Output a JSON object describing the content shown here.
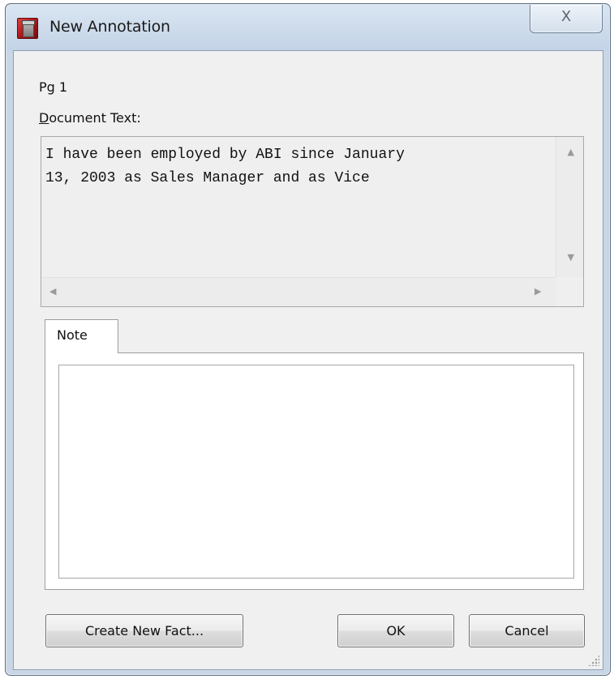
{
  "window": {
    "title": "New Annotation",
    "close_glyph": "X",
    "icon": "red-document-icon"
  },
  "page_label": "Pg 1",
  "document_text": {
    "label_first": "D",
    "label_rest": "ocument Text:",
    "content": "I have been employed by ABI since January\n13, 2003 as Sales Manager and as Vice"
  },
  "scroll_arrows": {
    "up": "▲",
    "down": "▼",
    "left": "◀",
    "right": "▶"
  },
  "tabs": [
    {
      "label": "Note",
      "selected": true
    }
  ],
  "note": {
    "value": ""
  },
  "buttons": {
    "create_new_fact": "Create New Fact...",
    "ok": "OK",
    "cancel": "Cancel"
  }
}
